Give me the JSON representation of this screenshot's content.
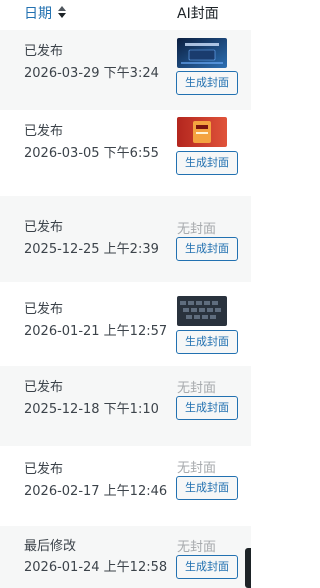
{
  "columns": {
    "date": "日期",
    "cover": "AI封面"
  },
  "rows": [
    {
      "status": "已发布",
      "time": "2026-03-29 下午3:24",
      "cover": "thumb",
      "thumb_theme": "blue-tech",
      "button": "生成封面"
    },
    {
      "status": "已发布",
      "time": "2026-03-05 下午6:55",
      "cover": "thumb",
      "thumb_theme": "red-promo",
      "button": "生成封面"
    },
    {
      "status": "已发布",
      "time": "2025-12-25 上午2:39",
      "cover": "none",
      "nocover": "无封面",
      "button": "生成封面"
    },
    {
      "status": "已发布",
      "time": "2026-01-21 上午12:57",
      "cover": "thumb",
      "thumb_theme": "keyboard",
      "button": "生成封面"
    },
    {
      "status": "已发布",
      "time": "2025-12-18 下午1:10",
      "cover": "none",
      "nocover": "无封面",
      "button": "生成封面"
    },
    {
      "status": "已发布",
      "time": "2026-02-17 上午12:46",
      "cover": "none",
      "nocover": "无封面",
      "button": "生成封面"
    },
    {
      "status": "最后修改",
      "time": "2026-01-24 上午12:58",
      "cover": "none",
      "nocover": "无封面",
      "button": "生成封面"
    }
  ],
  "colors": {
    "link": "#2271b1",
    "text": "#3c434a",
    "muted": "#a7aaad",
    "alt_row": "#f6f7f7"
  },
  "icons": {
    "sort": "sort-up-down-icon"
  }
}
